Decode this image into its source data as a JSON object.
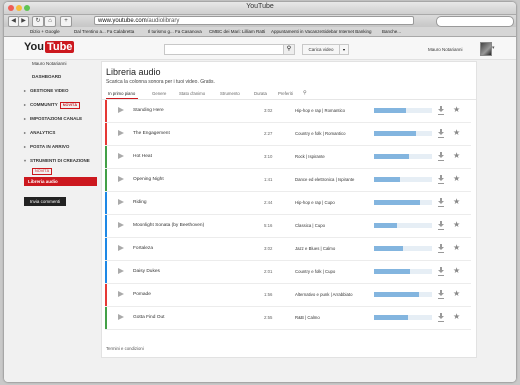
{
  "window": {
    "title": "YouTube"
  },
  "toolbar": {
    "url_host": "www.youtube.com",
    "url_path": "/audiolibrary",
    "back": "◀",
    "forward": "▶",
    "reload": "↻",
    "home": "⌂",
    "plus": "+"
  },
  "bookmarks": [
    "Dizio + Google",
    "Dal Trentino a... Fa Calabretta",
    "Il turismo g... Fa Casanova",
    "CMBC dei Mari: Lilliam Ratti",
    "Appuntamenti in Vacanze",
    "Sidebar Internet Banking",
    "Banche..."
  ],
  "header": {
    "logo_you": "You",
    "logo_tube": "Tube",
    "search_icon": "⚲",
    "upload_label": "Carica video",
    "upload_arrow": "▾",
    "username": "Mauro Notarianni",
    "avatar_arrow": "▾"
  },
  "sidebar": {
    "user": "Mauro Notarianni",
    "items": [
      {
        "label": "DASHBOARD",
        "tri": ""
      },
      {
        "label": "GESTIONE VIDEO",
        "tri": "▸"
      },
      {
        "label": "COMMUNITY",
        "tri": "▸",
        "badge": "NOVITÀ"
      },
      {
        "label": "IMPOSTAZIONI CANALE",
        "tri": "▸"
      },
      {
        "label": "ANALYTICS",
        "tri": "▸"
      },
      {
        "label": "POSTA IN ARRIVO",
        "tri": "▸"
      },
      {
        "label": "STRUMENTI DI CREAZIONE",
        "tri": "▾"
      }
    ],
    "tools_badge": "NOVITÀ",
    "active_item": "Libreria audio",
    "send_feedback": "Invia commenti"
  },
  "content": {
    "title": "Libreria audio",
    "subtitle": "Scarica la colonna sonora per i tuoi video. Gratis.",
    "tabs": [
      "In primo piano",
      "Genere",
      "Stato d'animo",
      "Strumento",
      "Durata",
      "Preferiti"
    ],
    "search_icon": "⚲",
    "footer_link": "Termini e condizioni"
  },
  "tracks": [
    {
      "name": "Standing Here",
      "duration": "3:02",
      "genre": "Hip-hop e rap | Romantico",
      "color": "#e53935",
      "progress": 0.55
    },
    {
      "name": "The Engagement",
      "duration": "2:27",
      "genre": "Country e folk | Romantico",
      "color": "#e53935",
      "progress": 0.72
    },
    {
      "name": "Hot Heat",
      "duration": "3:10",
      "genre": "Rock | Ispirante",
      "color": "#43a047",
      "progress": 0.6
    },
    {
      "name": "Opening Night",
      "duration": "1:41",
      "genre": "Dance ed elettronica | Ispirante",
      "color": "#43a047",
      "progress": 0.45
    },
    {
      "name": "Riding",
      "duration": "2:44",
      "genre": "Hip-hop e rap | Cupo",
      "color": "#1e88e5",
      "progress": 0.8
    },
    {
      "name": "Moonlight Sonata (by Beethoven)",
      "duration": "5:16",
      "genre": "Classica | Cupo",
      "color": "#1e88e5",
      "progress": 0.4
    },
    {
      "name": "Fortaleza",
      "duration": "3:02",
      "genre": "Jazz e Blues | Calmo",
      "color": "#1e88e5",
      "progress": 0.5
    },
    {
      "name": "Daisy Dukes",
      "duration": "2:01",
      "genre": "Country e folk | Cupo",
      "color": "#1e88e5",
      "progress": 0.62
    },
    {
      "name": "Pomade",
      "duration": "1:56",
      "genre": "Alternativo e punk | Arrabbiato",
      "color": "#e53935",
      "progress": 0.78
    },
    {
      "name": "Gotta Find Out",
      "duration": "2:55",
      "genre": "R&B | Calmo",
      "color": "#43a047",
      "progress": 0.58
    }
  ],
  "icons": {
    "play": "play-icon",
    "download": "download-icon",
    "star": "star-icon"
  },
  "star_glyph": "★"
}
